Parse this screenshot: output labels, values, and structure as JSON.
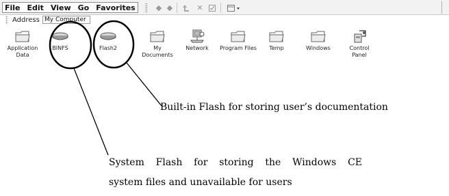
{
  "menubar": {
    "items": [
      {
        "label": "File"
      },
      {
        "label": "Edit"
      },
      {
        "label": "View"
      },
      {
        "label": "Go"
      },
      {
        "label": "Favorites"
      }
    ],
    "toolbar_icons": [
      "back-icon",
      "forward-icon",
      "up-folder-icon",
      "delete-icon",
      "properties-icon",
      "views-icon"
    ]
  },
  "address": {
    "label": "Address",
    "value": "My Computer"
  },
  "icons": [
    {
      "label": "Application\nData",
      "icon": "folder-icon"
    },
    {
      "label": "BINFS",
      "icon": "drive-icon"
    },
    {
      "label": "Flash2",
      "icon": "drive-icon"
    },
    {
      "label": "My\nDocuments",
      "icon": "folder-icon"
    },
    {
      "label": "Network",
      "icon": "network-icon"
    },
    {
      "label": "Program Files",
      "icon": "folder-icon"
    },
    {
      "label": "Temp",
      "icon": "folder-icon"
    },
    {
      "label": "Windows",
      "icon": "folder-icon"
    },
    {
      "label": "Control\nPanel",
      "icon": "control-panel-icon"
    }
  ],
  "annotations": {
    "flash2_note": "Built-in Flash for storing user’s documentation",
    "binfs_note_words": [
      "System",
      "Flash",
      "for",
      "storing",
      "the",
      "Windows",
      "CE"
    ],
    "binfs_note_line2": "system files and unavailable for users"
  }
}
